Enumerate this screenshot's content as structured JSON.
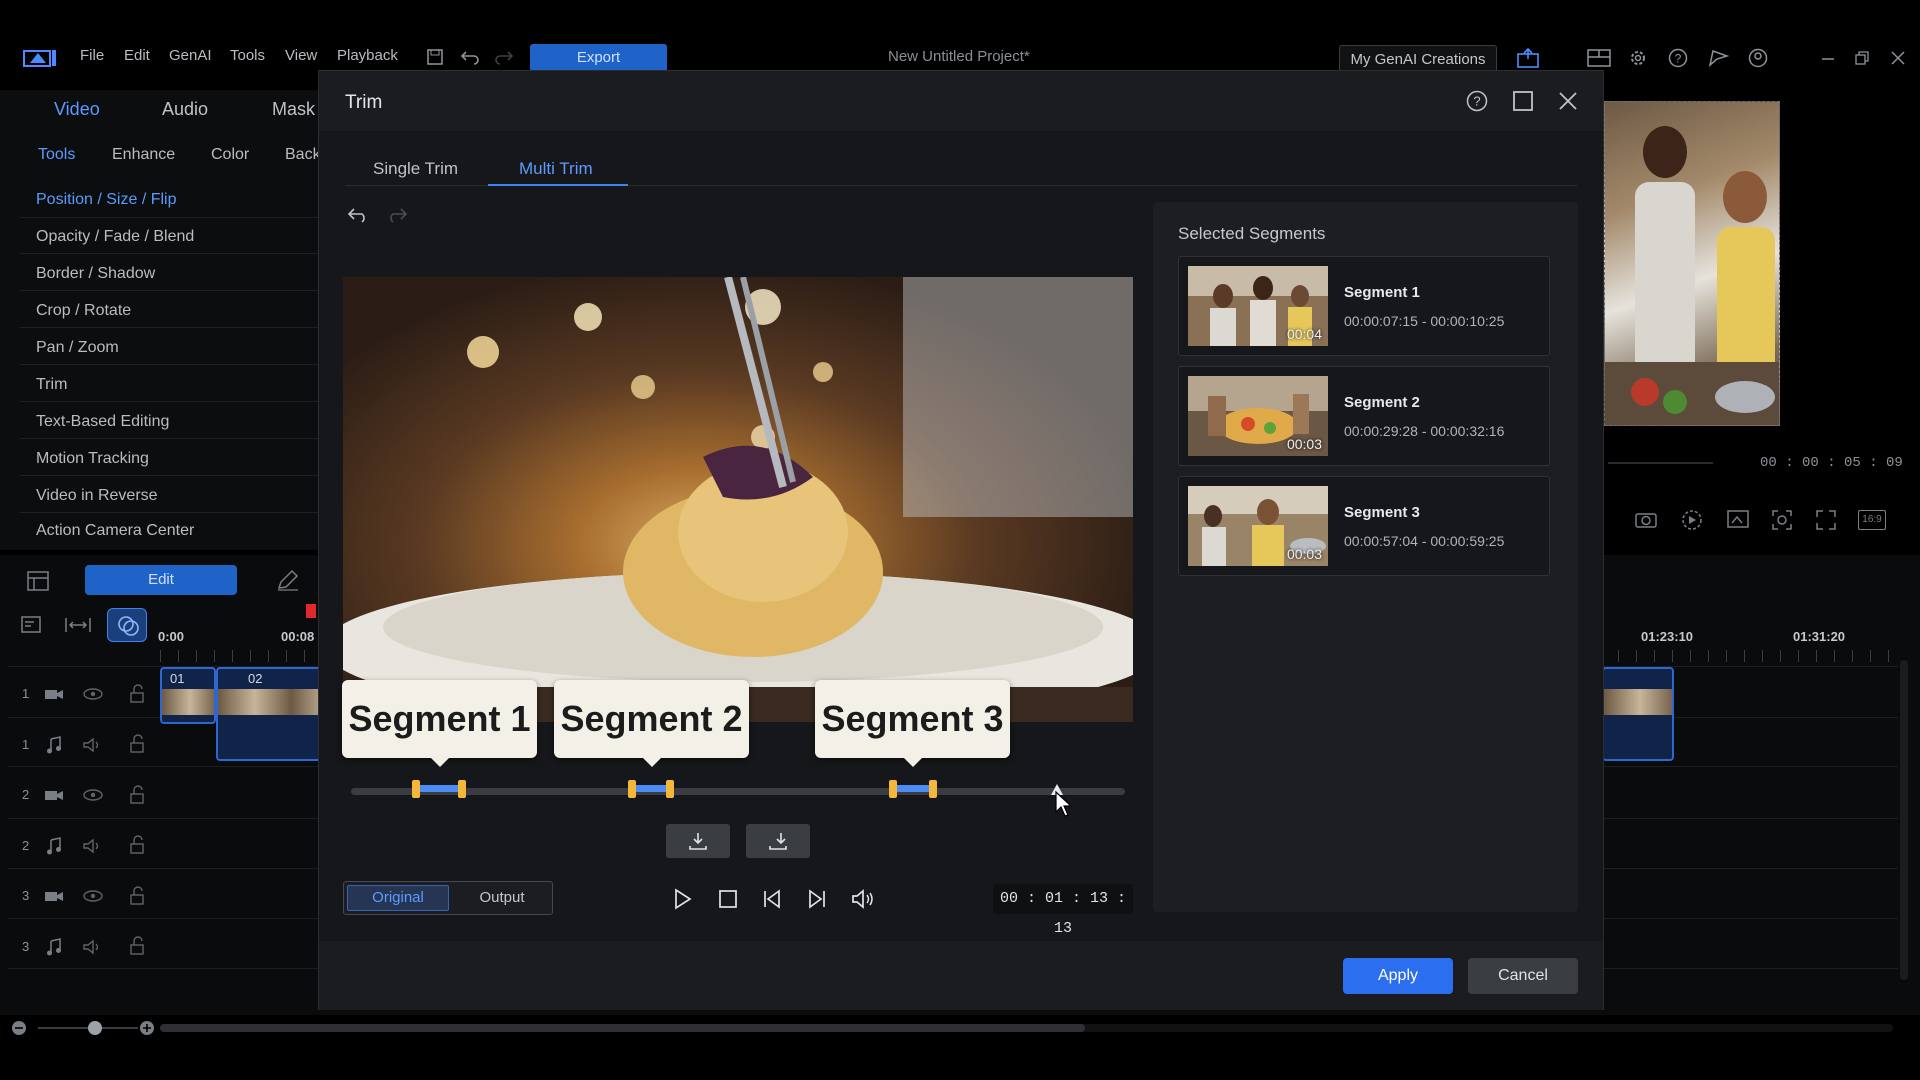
{
  "menu": {
    "items": [
      "File",
      "Edit",
      "GenAI",
      "Tools",
      "View",
      "Playback"
    ],
    "export_label": "Export",
    "project_title": "New Untitled Project*",
    "genai_creations_label": "My GenAI Creations"
  },
  "left_panel": {
    "main_tabs": [
      "Video",
      "Audio",
      "Mask"
    ],
    "sub_tabs": [
      "Tools",
      "Enhance",
      "Color",
      "Back"
    ],
    "tools": [
      "Position / Size / Flip",
      "Opacity / Fade / Blend",
      "Border / Shadow",
      "Crop / Rotate",
      "Pan / Zoom",
      "Trim",
      "Text-Based Editing",
      "Motion Tracking",
      "Video in Reverse",
      "Action Camera Center"
    ],
    "edit_label": "Edit"
  },
  "timeline": {
    "ruler": [
      "0:00",
      "00:08",
      "01:23:10",
      "01:31:20"
    ],
    "tracks": [
      {
        "num": "1",
        "kind": "video"
      },
      {
        "num": "1",
        "kind": "audio"
      },
      {
        "num": "2",
        "kind": "video"
      },
      {
        "num": "2",
        "kind": "audio"
      },
      {
        "num": "3",
        "kind": "video"
      },
      {
        "num": "3",
        "kind": "audio"
      }
    ],
    "clips": [
      "01",
      "02"
    ]
  },
  "preview": {
    "timecode": "00 : 00 : 05 : 09",
    "aspect_label": "16:9"
  },
  "dialog": {
    "title": "Trim",
    "tabs": [
      "Single Trim",
      "Multi Trim"
    ],
    "active_tab": "Multi Trim",
    "bubbles": [
      "Segment 1",
      "Segment 2",
      "Segment 3"
    ],
    "view_toggle": {
      "original": "Original",
      "output": "Output",
      "active": "Original"
    },
    "timecode": "00 : 01 : 13 : 13",
    "segments_title": "Selected Segments",
    "segments": [
      {
        "name": "Segment 1",
        "range": "00:00:07:15 - 00:00:10:25",
        "duration": "00:04"
      },
      {
        "name": "Segment 2",
        "range": "00:00:29:28 - 00:00:32:16",
        "duration": "00:03"
      },
      {
        "name": "Segment 3",
        "range": "00:00:57:04 - 00:00:59:25",
        "duration": "00:03"
      }
    ],
    "apply_label": "Apply",
    "cancel_label": "Cancel"
  },
  "colors": {
    "accent": "#3d84f0",
    "segment_handle": "#f4b73b",
    "dialog_bg": "#16171a"
  }
}
